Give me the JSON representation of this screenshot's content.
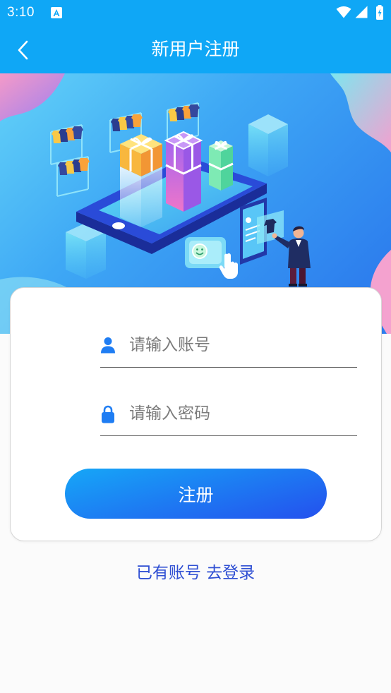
{
  "status_bar": {
    "time": "3:10",
    "icons": {
      "notification": "notification-a-icon",
      "wifi": "wifi-icon",
      "signal": "signal-icon",
      "battery": "battery-charging-icon"
    }
  },
  "header": {
    "back_icon": "chevron-left-icon",
    "title": "新用户注册"
  },
  "form": {
    "account": {
      "icon": "user-icon",
      "placeholder": "请输入账号"
    },
    "password": {
      "icon": "lock-icon",
      "placeholder": "请输入密码"
    },
    "submit_label": "注册"
  },
  "login_link": "已有账号 去登录",
  "colors": {
    "primary": "#0fa7f6",
    "icon_blue": "#1f7df3",
    "button_gradient": [
      "#16a7f7",
      "#2450ee"
    ],
    "link": "#2f4fd3",
    "page_background": "#fbfbfb"
  }
}
